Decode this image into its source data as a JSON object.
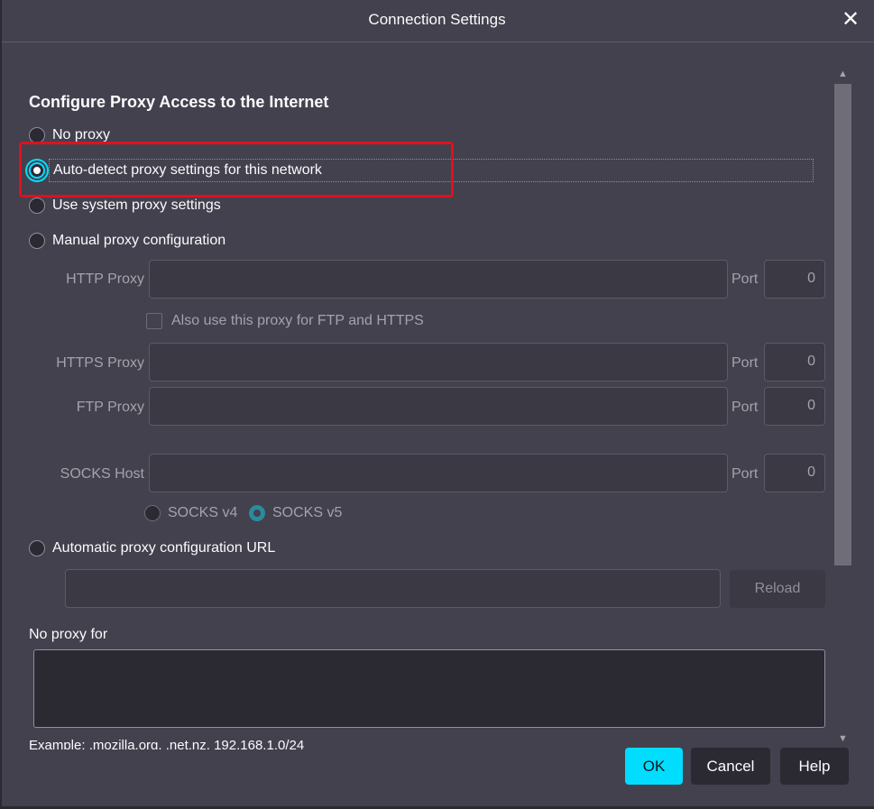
{
  "window": {
    "title": "Connection Settings",
    "close_icon": "close-icon"
  },
  "section": {
    "heading": "Configure Proxy Access to the Internet"
  },
  "proxy_options": {
    "no_proxy": "No proxy",
    "auto_detect": "Auto-detect proxy settings for this network",
    "system": "Use system proxy settings",
    "manual": "Manual proxy configuration",
    "auto_url": "Automatic proxy configuration URL",
    "selected": "auto_detect"
  },
  "manual": {
    "http_label": "HTTP Proxy",
    "https_label": "HTTPS Proxy",
    "ftp_label": "FTP Proxy",
    "socks_label": "SOCKS Host",
    "port_label": "Port",
    "http_port": "0",
    "https_port": "0",
    "ftp_port": "0",
    "socks_port": "0",
    "also_use_label": "Also use this proxy for FTP and HTTPS",
    "socks_v4": "SOCKS v4",
    "socks_v5": "SOCKS v5",
    "socks_selected": "socks_v5"
  },
  "auto_url": {
    "reload_label": "Reload"
  },
  "no_proxy_for": {
    "label": "No proxy for",
    "example": "Example: .mozilla.org, .net.nz, 192.168.1.0/24"
  },
  "buttons": {
    "ok": "OK",
    "cancel": "Cancel",
    "help": "Help"
  },
  "colors": {
    "accent": "#00ddff",
    "highlight": "#e0101e",
    "background": "#42414d"
  }
}
